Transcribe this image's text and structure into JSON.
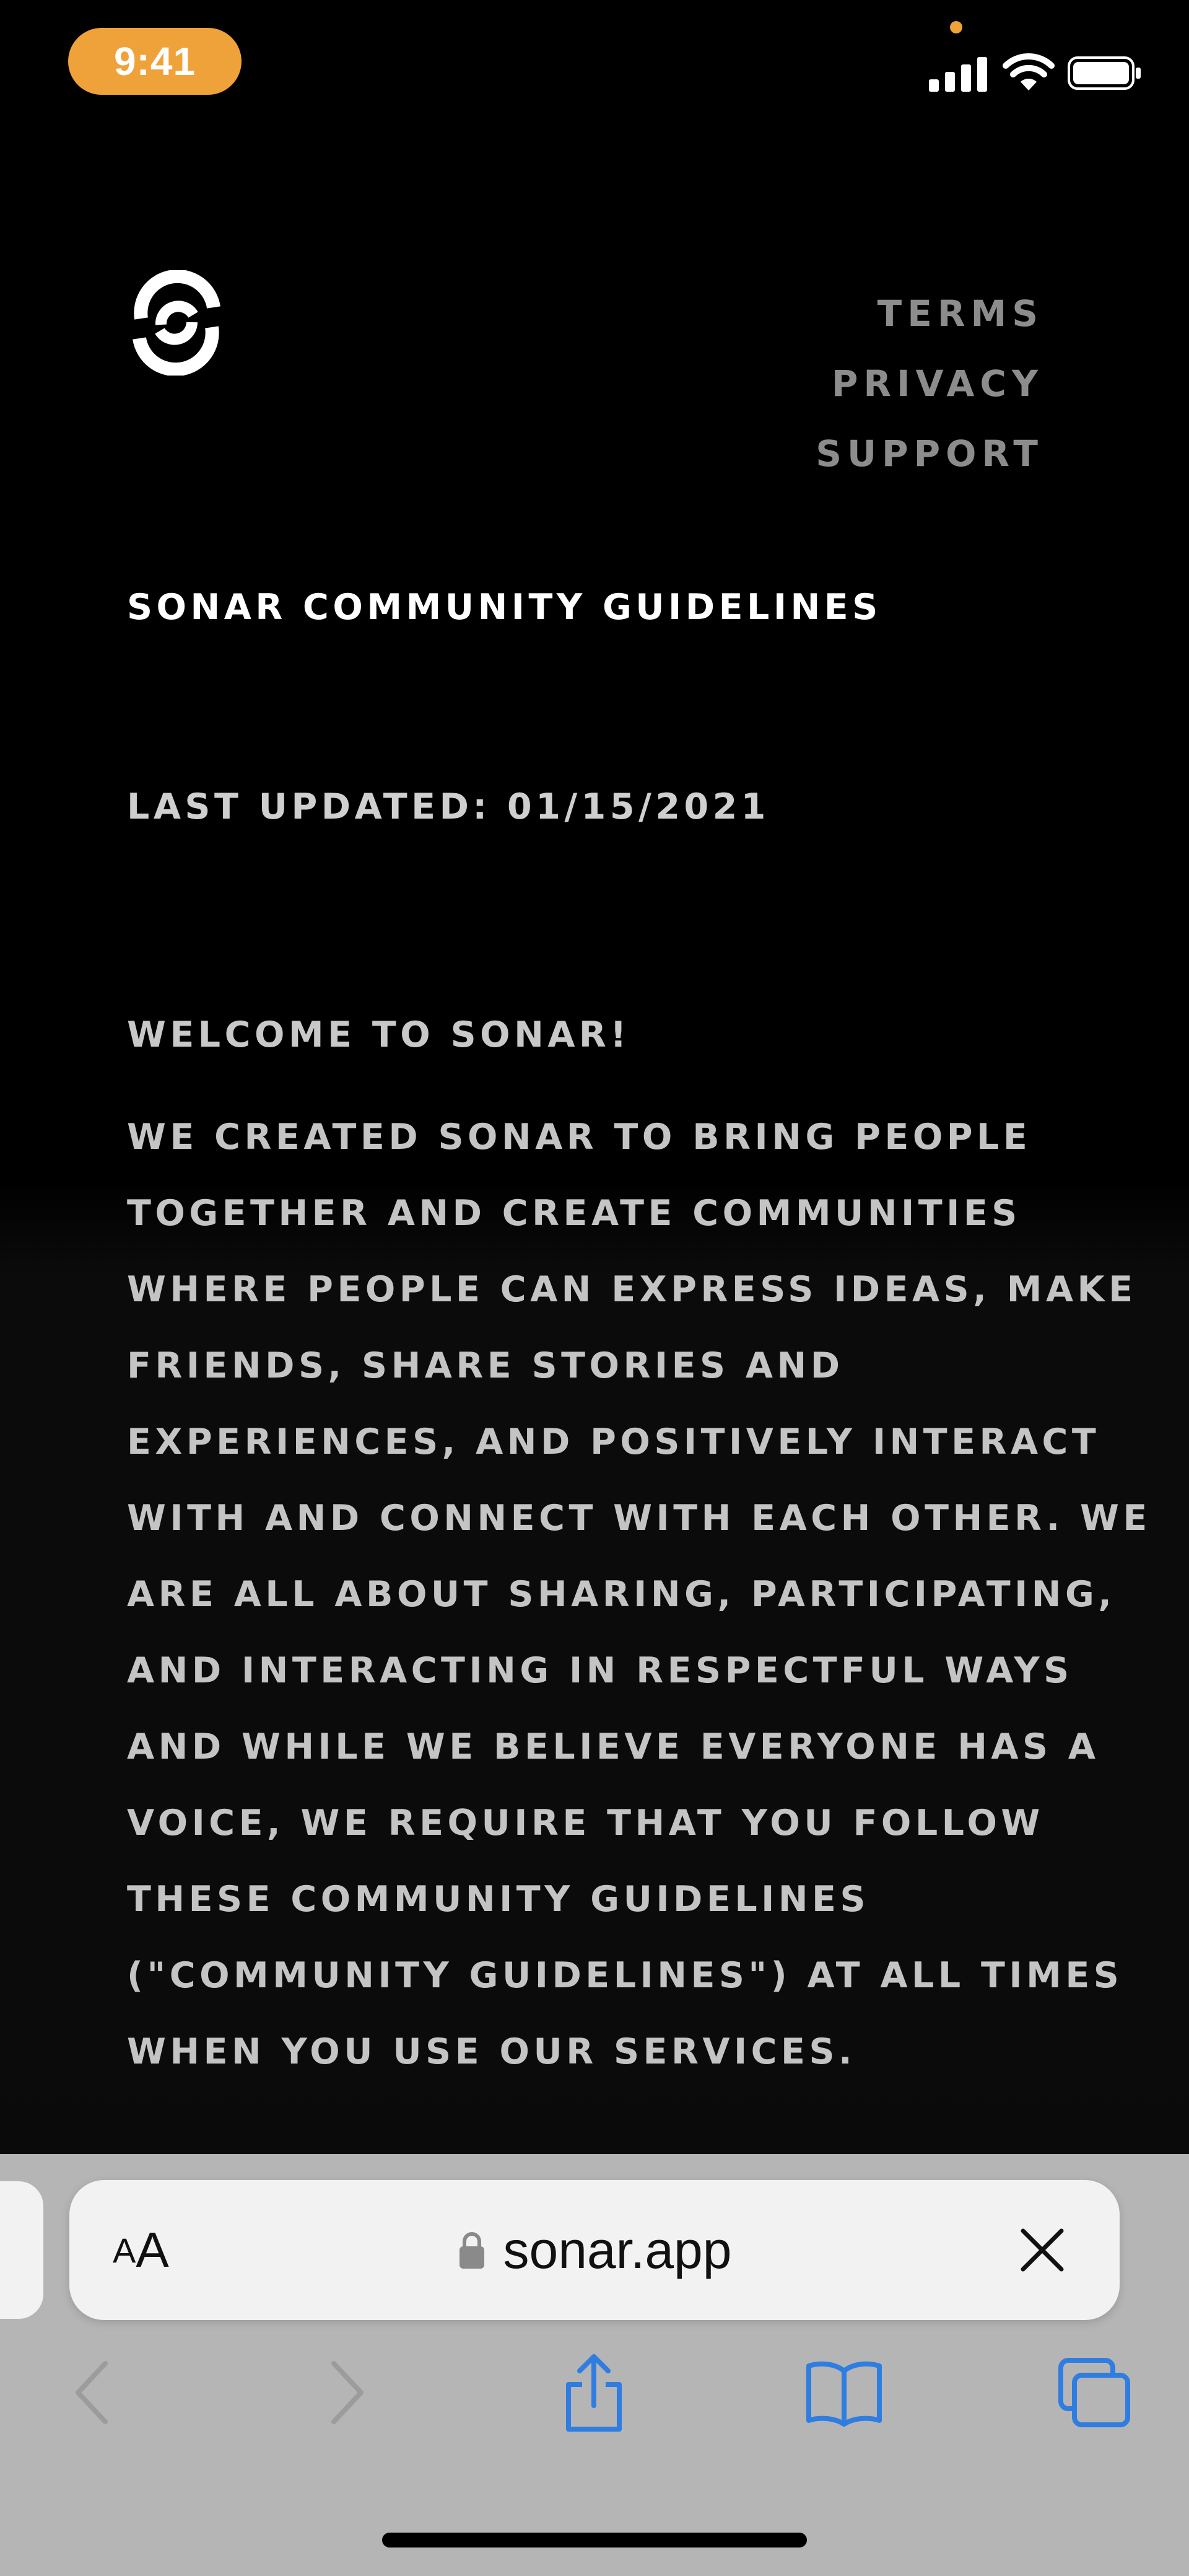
{
  "status_bar": {
    "time": "9:41"
  },
  "site_nav": {
    "links": [
      "TERMS",
      "PRIVACY",
      "SUPPORT"
    ]
  },
  "content": {
    "title": "SONAR COMMUNITY GUIDELINES",
    "last_updated": "LAST UPDATED: 01/15/2021",
    "welcome": "WELCOME TO SONAR!",
    "body_lines": [
      "WE CREATED SONAR TO BRING PEOPLE",
      "TOGETHER AND CREATE COMMUNITIES",
      "WHERE PEOPLE CAN EXPRESS IDEAS, MAKE",
      "FRIENDS, SHARE STORIES AND",
      "EXPERIENCES, AND POSITIVELY INTERACT",
      "WITH AND CONNECT WITH EACH OTHER. WE",
      "ARE ALL ABOUT SHARING, PARTICIPATING,",
      "AND INTERACTING IN RESPECTFUL WAYS",
      "AND WHILE WE BELIEVE EVERYONE HAS A",
      "VOICE, WE REQUIRE THAT YOU FOLLOW",
      "THESE COMMUNITY GUIDELINES",
      "(\"COMMUNITY GUIDELINES\") AT ALL TIMES",
      "WHEN YOU USE OUR SERVICES."
    ]
  },
  "browser": {
    "text_size_small": "A",
    "text_size_large": "A",
    "url": "sonar.app"
  },
  "icons": {
    "logo": "sonar-logo-icon",
    "back": "chevron-left-icon",
    "forward": "chevron-right-icon",
    "share": "share-icon",
    "bookmarks": "book-icon",
    "tabs": "tabs-icon",
    "close": "close-icon",
    "lock": "lock-icon"
  },
  "colors": {
    "status_pill": "#f0a23a",
    "toolbar_bg": "#b5b5b5",
    "accent_blue": "#2f7de1",
    "nav_link_gray": "#8c8c8c"
  }
}
